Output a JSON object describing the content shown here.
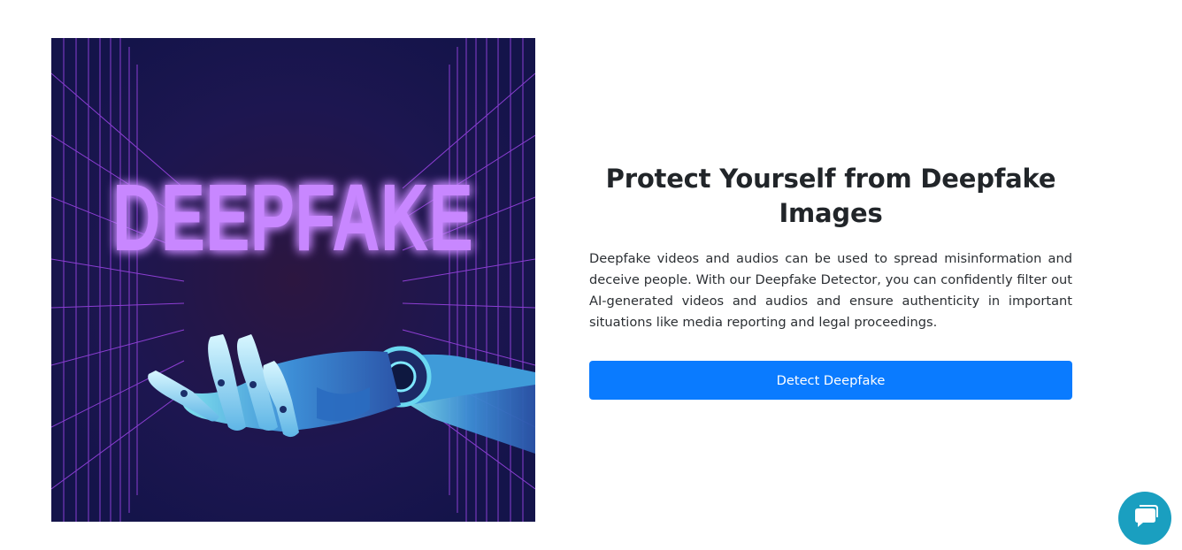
{
  "hero": {
    "image_text": "DEEPFAKE",
    "image_alt_icon": "robot-hand-illustration"
  },
  "content": {
    "title": "Protect Yourself from Deepfake Images",
    "description": "Deepfake videos and audios can be used to spread misinformation and deceive people. With our Deepfake Detector, you can confidently filter out AI-generated videos and audios and ensure authenticity in important situations like media reporting and legal proceedings.",
    "button_label": "Detect Deepfake"
  },
  "chat": {
    "icon": "chat-bubble-icon"
  },
  "colors": {
    "button": "#0a7bff",
    "chat_widget": "#1a9fc0",
    "neon_text": "#c887ff",
    "grid_lines": "#b14cff"
  }
}
